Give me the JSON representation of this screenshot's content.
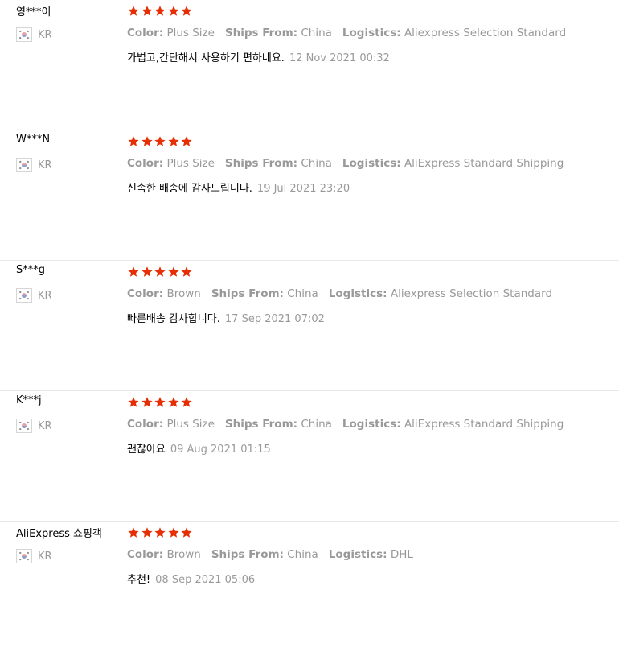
{
  "theme": {
    "star_color": "#e62e04"
  },
  "reviews": [
    {
      "user": "영***이",
      "country": "KR",
      "rating": 5,
      "attributes": [
        {
          "label": "Color:",
          "value": "Plus Size"
        },
        {
          "label": "Ships From:",
          "value": "China"
        },
        {
          "label": "Logistics:",
          "value": "Aliexpress Selection Standard"
        }
      ],
      "text": "가볍고,간단해서 사용하기 편하네요.",
      "date": "12 Nov 2021 00:32"
    },
    {
      "user": "W***N",
      "country": "KR",
      "rating": 5,
      "attributes": [
        {
          "label": "Color:",
          "value": "Plus Size"
        },
        {
          "label": "Ships From:",
          "value": "China"
        },
        {
          "label": "Logistics:",
          "value": "AliExpress Standard Shipping"
        }
      ],
      "text": "신속한 배송에 감사드립니다.",
      "date": "19 Jul 2021 23:20"
    },
    {
      "user": "S***g",
      "country": "KR",
      "rating": 5,
      "attributes": [
        {
          "label": "Color:",
          "value": "Brown"
        },
        {
          "label": "Ships From:",
          "value": "China"
        },
        {
          "label": "Logistics:",
          "value": "Aliexpress Selection Standard"
        }
      ],
      "text": "빠른배송 감사합니다.",
      "date": "17 Sep 2021 07:02"
    },
    {
      "user": "K***j",
      "country": "KR",
      "rating": 5,
      "attributes": [
        {
          "label": "Color:",
          "value": "Plus Size"
        },
        {
          "label": "Ships From:",
          "value": "China"
        },
        {
          "label": "Logistics:",
          "value": "AliExpress Standard Shipping"
        }
      ],
      "text": "괜찮아요",
      "date": "09 Aug 2021 01:15"
    },
    {
      "user": "AliExpress 쇼핑객",
      "country": "KR",
      "rating": 5,
      "attributes": [
        {
          "label": "Color:",
          "value": "Brown"
        },
        {
          "label": "Ships From:",
          "value": "China"
        },
        {
          "label": "Logistics:",
          "value": "DHL"
        }
      ],
      "text": "추천!",
      "date": "08 Sep 2021 05:06"
    }
  ]
}
